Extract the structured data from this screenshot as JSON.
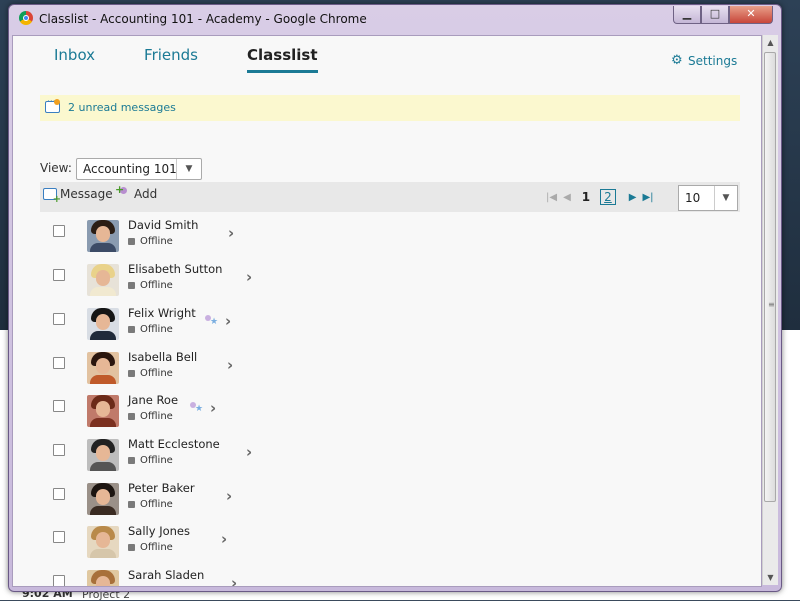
{
  "window": {
    "title": "Classlist - Accounting 101 - Academy - Google Chrome"
  },
  "tabs": [
    {
      "label": "Inbox",
      "active": false
    },
    {
      "label": "Friends",
      "active": false
    },
    {
      "label": "Classlist",
      "active": true
    }
  ],
  "settings_label": "Settings",
  "banner": {
    "text": "2 unread messages",
    "icon": "unread-messages-icon"
  },
  "view": {
    "label": "View:",
    "selected": "Accounting 101"
  },
  "toolbar": {
    "message_label": "Message",
    "add_label": "Add"
  },
  "pager": {
    "current_page": "1",
    "other_page": "2",
    "per_page": "10"
  },
  "students": [
    {
      "name": "David Smith",
      "status": "Offline",
      "has_role_icon": false,
      "colors": {
        "hair": "#2b1d14",
        "body": "#3c4b66",
        "bg": "#8a9bb0"
      }
    },
    {
      "name": "Elisabeth Sutton",
      "status": "Offline",
      "has_role_icon": false,
      "colors": {
        "hair": "#e9d28a",
        "body": "#f1e9d0",
        "bg": "#e7e2d8"
      }
    },
    {
      "name": "Felix Wright",
      "status": "Offline",
      "has_role_icon": true,
      "colors": {
        "hair": "#161616",
        "body": "#202a3a",
        "bg": "#d8dde4"
      }
    },
    {
      "name": "Isabella Bell",
      "status": "Offline",
      "has_role_icon": false,
      "colors": {
        "hair": "#2a160e",
        "body": "#c05a2a",
        "bg": "#e2c2a0"
      }
    },
    {
      "name": "Jane Roe",
      "status": "Offline",
      "has_role_icon": true,
      "colors": {
        "hair": "#6b2a18",
        "body": "#7b3020",
        "bg": "#c07a6a"
      }
    },
    {
      "name": "Matt Ecclestone",
      "status": "Offline",
      "has_role_icon": false,
      "colors": {
        "hair": "#222222",
        "body": "#555555",
        "bg": "#bdbdbd"
      }
    },
    {
      "name": "Peter Baker",
      "status": "Offline",
      "has_role_icon": false,
      "colors": {
        "hair": "#1c1410",
        "body": "#3a2b22",
        "bg": "#9a9088"
      }
    },
    {
      "name": "Sally Jones",
      "status": "Offline",
      "has_role_icon": false,
      "colors": {
        "hair": "#b98a4a",
        "body": "#d6c6aa",
        "bg": "#e6d8c0"
      }
    },
    {
      "name": "Sarah Sladen",
      "status": "Offline",
      "has_role_icon": false,
      "colors": {
        "hair": "#a8703a",
        "body": "#c9a87a",
        "bg": "#e0c8a0"
      }
    }
  ],
  "taskbar": {
    "time": "9:02 AM",
    "item": "Project 2"
  },
  "colors": {
    "link": "#1b7a95",
    "banner_bg": "#fbf8cf"
  }
}
